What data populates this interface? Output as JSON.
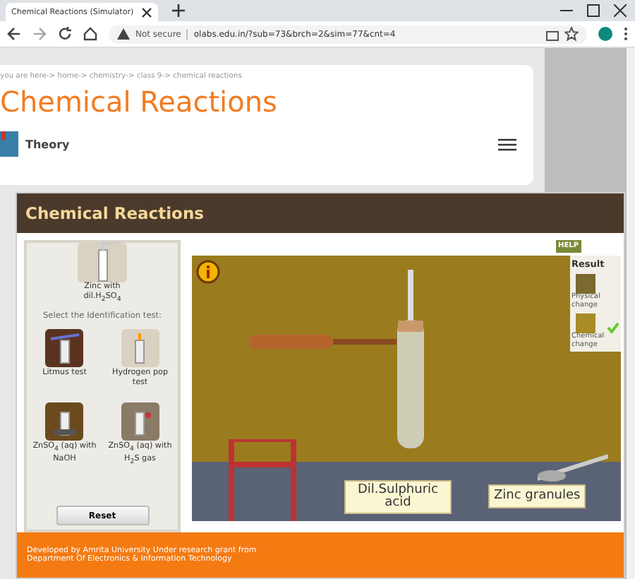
{
  "browser": {
    "tab_title": "Chemical Reactions (Simulator)",
    "security": "Not secure",
    "url": "olabs.edu.in/?sub=73&brch=2&sim=77&cnt=4"
  },
  "page": {
    "breadcrumb": "you are here-> home-> chemistry-> class 9-> chemical reactions",
    "title": "Chemical Reactions",
    "section": "Theory"
  },
  "simulator": {
    "title": "Chemical Reactions",
    "help": "HELP",
    "sample": "Zinc with dil.H$_{2}$SO$_{4}$",
    "prompt": "Select the Identification test:",
    "tests": [
      {
        "label": "Litmus test",
        "kind": "litmus"
      },
      {
        "label": "Hydrogen pop test",
        "kind": "pop"
      },
      {
        "label": "ZnSO$_{4}$ (aq) with NaOH",
        "kind": "naoh"
      },
      {
        "label": "ZnSO$_{4}$ (aq) with H$_{2}$S gas",
        "kind": "h2s"
      }
    ],
    "reset": "Reset",
    "result": {
      "title": "Result",
      "options": [
        {
          "label": "Physical change",
          "selected": false
        },
        {
          "label": "Chemical change",
          "selected": true
        }
      ]
    },
    "labels": [
      "Dil.Sulphuric acid",
      "Zinc granules"
    ],
    "footer": "Developed by Amrita University Under research grant from Department Of Electronics & Information Technology"
  }
}
